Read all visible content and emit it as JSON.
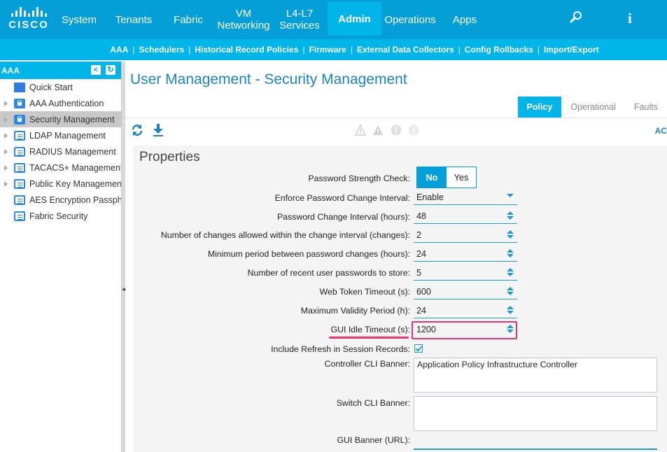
{
  "topnav": {
    "logo": "CISCO",
    "items": [
      {
        "label": "System"
      },
      {
        "label": "Tenants"
      },
      {
        "label": "Fabric"
      },
      {
        "label": "VM Networking"
      },
      {
        "label": "L4-L7 Services"
      },
      {
        "label": "Admin",
        "active": true
      },
      {
        "label": "Operations"
      },
      {
        "label": "Apps"
      }
    ],
    "icons": {
      "search": "search-icon",
      "info": "i"
    }
  },
  "subnav": {
    "items": [
      "AAA",
      "Schedulers",
      "Historical Record Policies",
      "Firmware",
      "External Data Collectors",
      "Config Rollbacks",
      "Import/Export"
    ]
  },
  "sidebar": {
    "title": "AAA",
    "items": [
      {
        "label": "Quick Start",
        "icon": "folder-icon",
        "expandable": false
      },
      {
        "label": "AAA Authentication",
        "icon": "lock-icon",
        "expandable": true
      },
      {
        "label": "Security Management",
        "icon": "lock-icon",
        "expandable": true,
        "selected": true
      },
      {
        "label": "LDAP Management",
        "icon": "policy-scroll-icon",
        "expandable": true
      },
      {
        "label": "RADIUS Management",
        "icon": "policy-scroll-icon",
        "expandable": true
      },
      {
        "label": "TACACS+ Management",
        "icon": "policy-scroll-icon",
        "expandable": true
      },
      {
        "label": "Public Key Management",
        "icon": "policy-scroll-icon",
        "expandable": true
      },
      {
        "label": "AES Encryption Passphrase",
        "icon": "policy-scroll-icon",
        "expandable": false
      },
      {
        "label": "Fabric Security",
        "icon": "policy-scroll-icon",
        "expandable": false
      }
    ]
  },
  "main": {
    "title": "User Management - Security Management",
    "tabs": [
      {
        "label": "Policy",
        "active": true
      },
      {
        "label": "Operational"
      },
      {
        "label": "Faults"
      }
    ],
    "action_link": "AC",
    "properties": {
      "title": "Properties",
      "password_strength_check": {
        "label": "Password Strength Check:",
        "options": [
          "No",
          "Yes"
        ],
        "selected": "No"
      },
      "enforce_interval": {
        "label": "Enforce Password Change Interval:",
        "value": "Enable"
      },
      "change_interval": {
        "label": "Password Change Interval (hours):",
        "value": "48"
      },
      "changes_allowed": {
        "label": "Number of changes allowed within the change interval (changes):",
        "value": "2"
      },
      "min_period": {
        "label": "Minimum period between password changes (hours):",
        "value": "24"
      },
      "recent_passwords": {
        "label": "Number of recent user passwords to store:",
        "value": "5"
      },
      "web_token_timeout": {
        "label": "Web Token Timeout (s):",
        "value": "600"
      },
      "max_validity": {
        "label": "Maximum Validity Period (h):",
        "value": "24"
      },
      "gui_idle_timeout": {
        "label": "GUI Idle Timeout (s):",
        "value": "1200"
      },
      "include_refresh": {
        "label": "Include Refresh in Session Records:",
        "checked": true
      },
      "controller_banner": {
        "label": "Controller CLI Banner:",
        "value": "Application Policy Infrastructure Controller"
      },
      "switch_banner": {
        "label": "Switch CLI Banner:",
        "value": ""
      },
      "gui_banner": {
        "label": "GUI Banner (URL):",
        "value": ""
      }
    }
  },
  "colors": {
    "topbar": "#049fd9",
    "accent": "#00b5ea",
    "title": "#1b83c5",
    "highlight": "#f0326e"
  }
}
